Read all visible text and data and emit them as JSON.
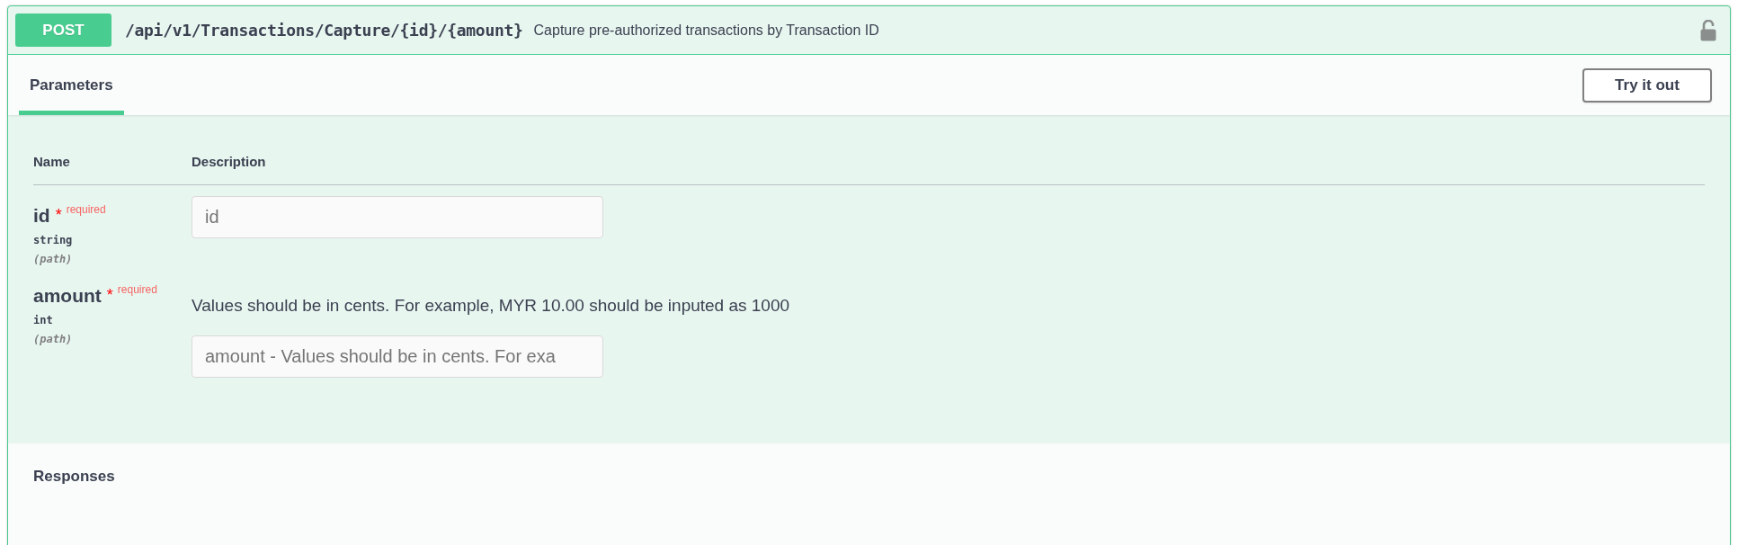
{
  "operation": {
    "method": "POST",
    "path": "/api/v1/Transactions/Capture/{id}/{amount}",
    "summary": "Capture pre-authorized transactions by Transaction ID",
    "locked": false
  },
  "tabs": [
    {
      "label": "Parameters",
      "selected": true
    }
  ],
  "try_button": "Try it out",
  "columns": [
    "Name",
    "Description"
  ],
  "parameters": [
    {
      "name": "id",
      "required": true,
      "required_mark": "*",
      "required_label": "required",
      "type": "string",
      "location": "(path)",
      "placeholder": "id"
    },
    {
      "name": "amount",
      "required": true,
      "required_mark": "*",
      "required_label": "required",
      "type": "int",
      "location": "(path)",
      "description": "Values should be in cents. For example, MYR 10.00 should be inputed as 1000",
      "placeholder": "amount - Values should be in cents. For exa"
    }
  ],
  "responses_title": "Responses"
}
